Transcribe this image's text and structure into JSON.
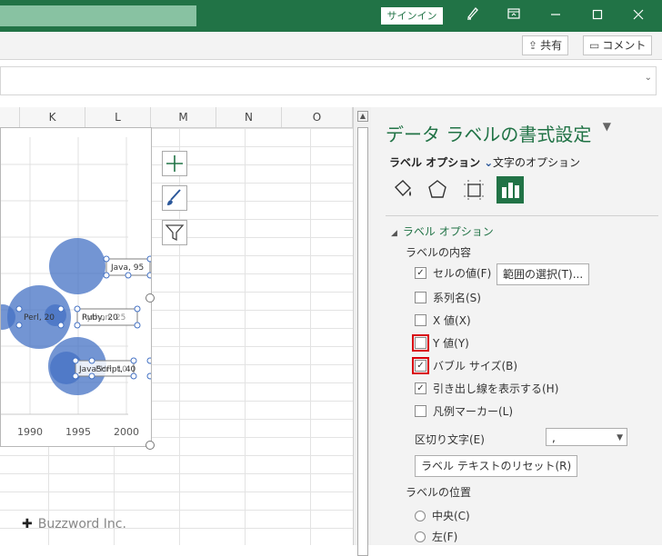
{
  "titlebar": {
    "signin_label": "サインイン"
  },
  "ribbon": {
    "share_label": "共有",
    "comments_label": "コメント"
  },
  "columns": [
    "K",
    "L",
    "M",
    "N",
    "O"
  ],
  "chart_data": {
    "type": "scatter",
    "x_ticks": [
      "1990",
      "1995",
      "2000"
    ],
    "labels": [
      {
        "text": "Java, 95"
      },
      {
        "text": "Perl, 20"
      },
      {
        "text": "Ruby, 20"
      },
      {
        "text": "Python, 25"
      },
      {
        "text": "JavaScript, 40"
      },
      {
        "text": "PHP, 10"
      }
    ]
  },
  "watermark": "Buzzword Inc.",
  "pane": {
    "title": "データ ラベルの書式設定",
    "tab_label_options": "ラベル オプション",
    "tab_text_options": "文字のオプション",
    "section_title": "ラベル オプション",
    "label_contents": "ラベルの内容",
    "checkboxes": [
      {
        "label": "セルの値(F)",
        "checked": "✓"
      },
      {
        "label": "系列名(S)",
        "checked": ""
      },
      {
        "label": "X 値(X)",
        "checked": ""
      },
      {
        "label": "Y 値(Y)",
        "checked": ""
      },
      {
        "label": "バブル サイズ(B)",
        "checked": "✓"
      },
      {
        "label": "引き出し線を表示する(H)",
        "checked": "✓"
      },
      {
        "label": "凡例マーカー(L)",
        "checked": ""
      }
    ],
    "range_button": "範囲の選択(T)...",
    "separator_label": "区切り文字(E)",
    "separator_value": ",",
    "reset_button": "ラベル テキストのリセット(R)",
    "label_position": "ラベルの位置",
    "position_center": "中央(C)",
    "position_left": "左(F)"
  }
}
